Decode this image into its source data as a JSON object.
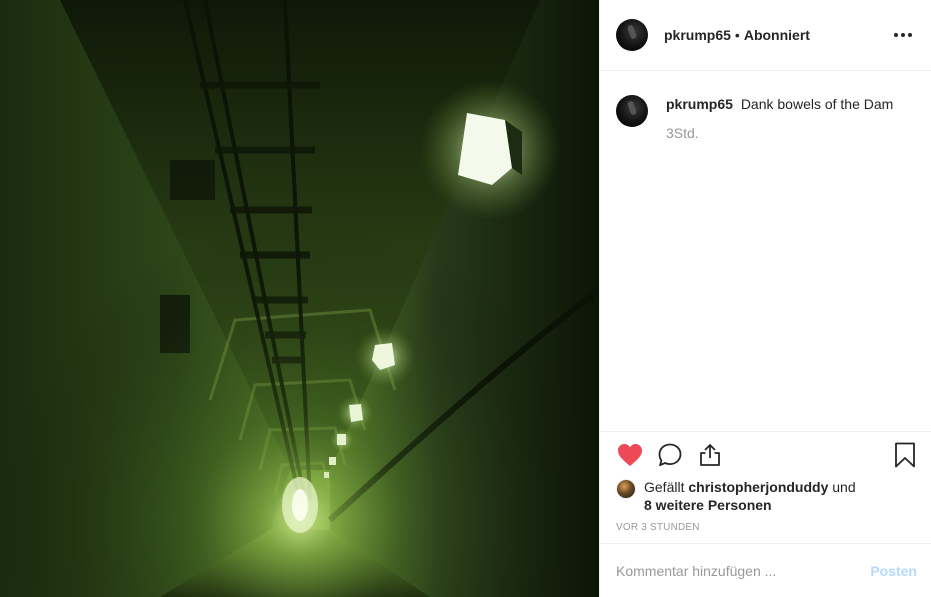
{
  "post": {
    "username": "pkrump65",
    "separator": "•",
    "follow_status": "Abonniert",
    "caption_text": "Dank bowels of the Dam",
    "caption_time": "3Std.",
    "liked": true,
    "likes_prefix": "Gefällt",
    "likes_user": "christopherjonduddy",
    "likes_connector": "und",
    "likes_others": "8 weitere Personen",
    "post_age": "VOR 3 STUNDEN"
  },
  "photo": {
    "subject": "green-lit-dam-tunnel"
  },
  "comment": {
    "placeholder": "Kommentar hinzufügen ...",
    "value": "",
    "post_label": "Posten"
  },
  "icons": {
    "more": "more-options-icon",
    "like": "heart-icon",
    "comment": "comment-icon",
    "share": "share-icon",
    "save": "bookmark-icon"
  },
  "colors": {
    "heart": "#ed4956",
    "post_button": "#b3dbff",
    "muted_text": "#999999",
    "text": "#262626",
    "divider": "#efefef"
  }
}
